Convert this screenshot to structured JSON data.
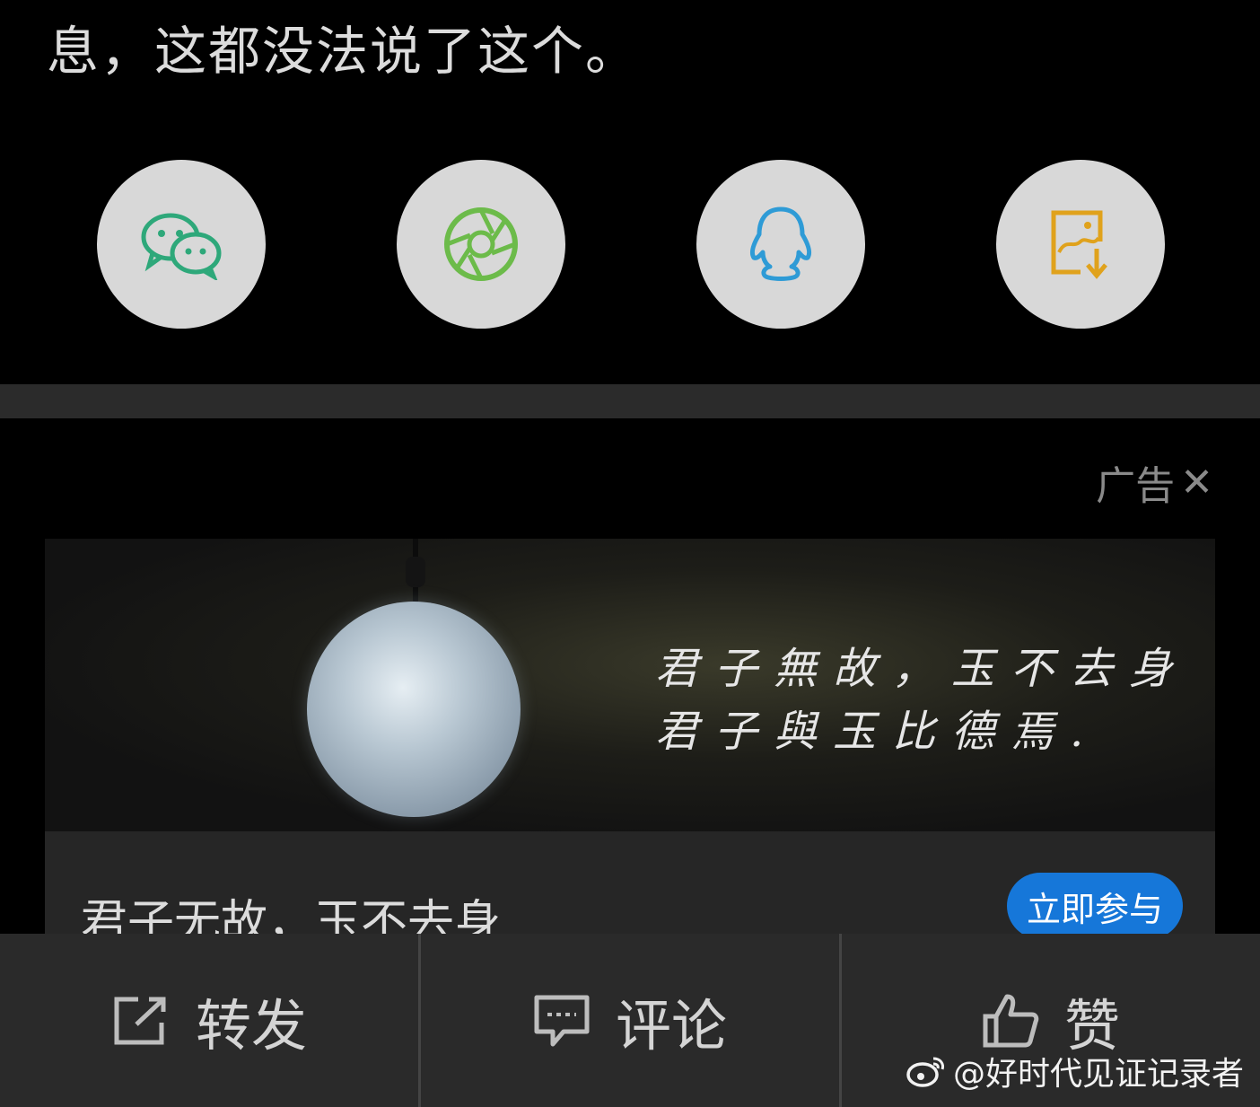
{
  "post": {
    "text_tail": "息，这都没法说了这个。"
  },
  "share": {
    "items": [
      {
        "name": "wechat",
        "icon": "wechat-icon",
        "color": "#2ea87a"
      },
      {
        "name": "moments",
        "icon": "moments-icon",
        "color": "#6cbb4a"
      },
      {
        "name": "qq",
        "icon": "qq-icon",
        "color": "#2e9bd6"
      },
      {
        "name": "save-image",
        "icon": "save-image-icon",
        "color": "#e0a21c"
      }
    ]
  },
  "ad": {
    "label": "广告",
    "close_symbol": "✕",
    "image_text_line1": "君子無故，玉不去身",
    "image_text_line2": "君子與玉比德焉.",
    "title": "君子无故，玉不去身",
    "cta": "立即参与",
    "cta_color": "#1677d9"
  },
  "actions": {
    "repost": "转发",
    "comment": "评论",
    "like": "赞"
  },
  "watermark": {
    "text": "@好时代见证记录者"
  }
}
